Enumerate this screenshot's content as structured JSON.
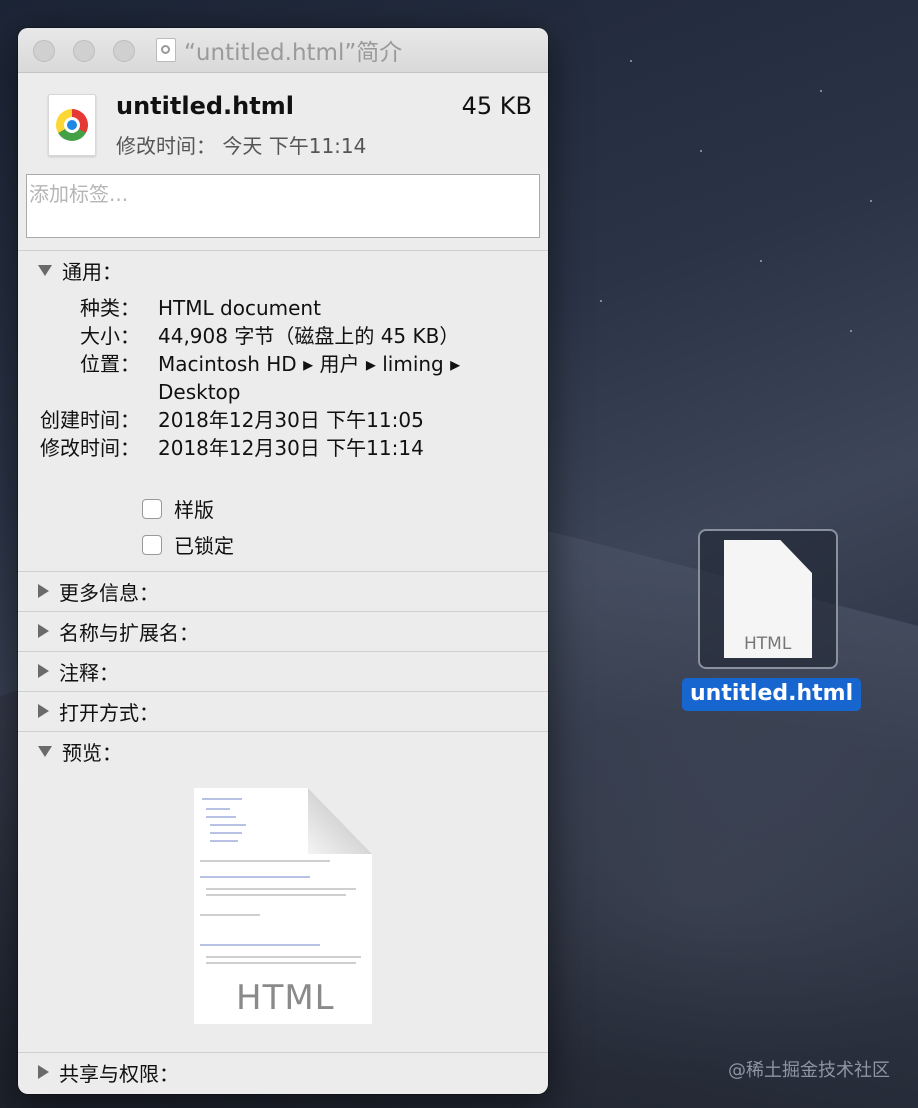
{
  "window": {
    "title": "“untitled.html”简介",
    "file_name": "untitled.html",
    "file_size": "45 KB",
    "modified_summary": "修改时间：  今天 下午11:14",
    "tags_placeholder": "添加标签..."
  },
  "sections": {
    "general": "通用：",
    "more_info": "更多信息：",
    "name_ext": "名称与扩展名：",
    "comments": "注释：",
    "open_with": "打开方式：",
    "preview": "预览：",
    "sharing": "共享与权限："
  },
  "general": {
    "kind_label": "种类：",
    "kind_value": "HTML document",
    "size_label": "大小：",
    "size_value": "44,908 字节（磁盘上的 45 KB）",
    "where_label": "位置：",
    "where_value": "Macintosh HD ▸ 用户 ▸ liming ▸ Desktop",
    "created_label": "创建时间：",
    "created_value": "2018年12月30日 下午11:05",
    "modified_label": "修改时间：",
    "modified_value": "2018年12月30日 下午11:14",
    "stationery_label": "样版",
    "locked_label": "已锁定"
  },
  "preview": {
    "doc_label": "HTML"
  },
  "desktop": {
    "file_label": "untitled.html",
    "doc_label": "HTML",
    "watermark": "@稀土掘金技术社区"
  },
  "icons": [
    "chrome-icon",
    "html-document-icon",
    "disclosure-triangle-icon",
    "checkbox"
  ]
}
